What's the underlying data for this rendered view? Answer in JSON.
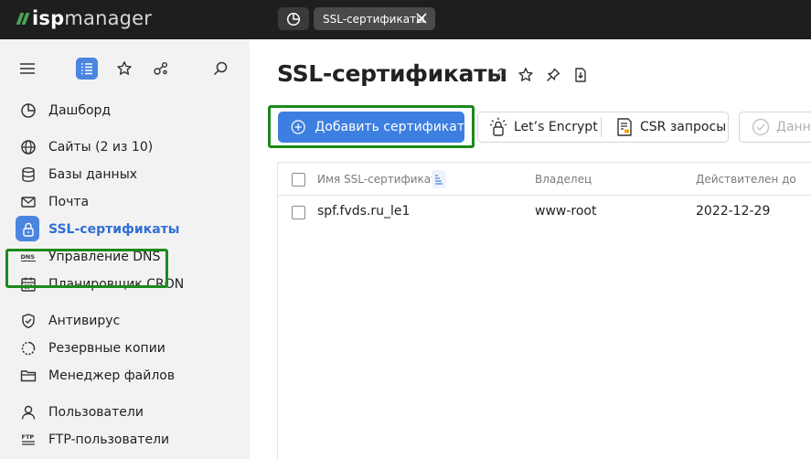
{
  "app": {
    "logo_prefix": "isp",
    "logo_suffix": "manager"
  },
  "topbar": {
    "tabs": [
      {
        "label": "SSL-сертификаты"
      }
    ]
  },
  "sidebar": {
    "items": [
      {
        "label": "Дашборд",
        "icon": "dashboard-icon"
      },
      {
        "label": "Сайты (2 из 10)",
        "icon": "globe-icon"
      },
      {
        "label": "Базы данных",
        "icon": "database-icon"
      },
      {
        "label": "Почта",
        "icon": "mail-icon"
      },
      {
        "label": "SSL-сертификаты",
        "icon": "lock-icon",
        "active": true
      },
      {
        "label": "Управление DNS",
        "icon": "dns-icon"
      },
      {
        "label": "Планировщик CRON",
        "icon": "calendar-icon"
      },
      {
        "label": "Антивирус",
        "icon": "shield-icon"
      },
      {
        "label": "Резервные копии",
        "icon": "backup-icon"
      },
      {
        "label": "Менеджер файлов",
        "icon": "folder-icon"
      },
      {
        "label": "Пользователи",
        "icon": "user-icon"
      },
      {
        "label": "FTP-пользователи",
        "icon": "ftp-icon"
      }
    ]
  },
  "main": {
    "title": "SSL-сертификаты",
    "toolbar": {
      "add_label": "Добавить сертификат",
      "letsencrypt_label": "Let’s Encrypt",
      "csr_label": "CSR запросы",
      "data_label": "Данны"
    },
    "table": {
      "columns": [
        "Имя SSL-сертификата",
        "Владелец",
        "Действителен до"
      ],
      "rows": [
        [
          "spf.fvds.ru_le1",
          "www-root",
          "2022-12-29"
        ]
      ]
    }
  },
  "colors": {
    "accent": "#3d7fe0",
    "topbar": "#1e1e1e",
    "sidebar": "#f2f2f2",
    "highlight": "#1b8a1b",
    "logo_green": "#4aa458"
  }
}
